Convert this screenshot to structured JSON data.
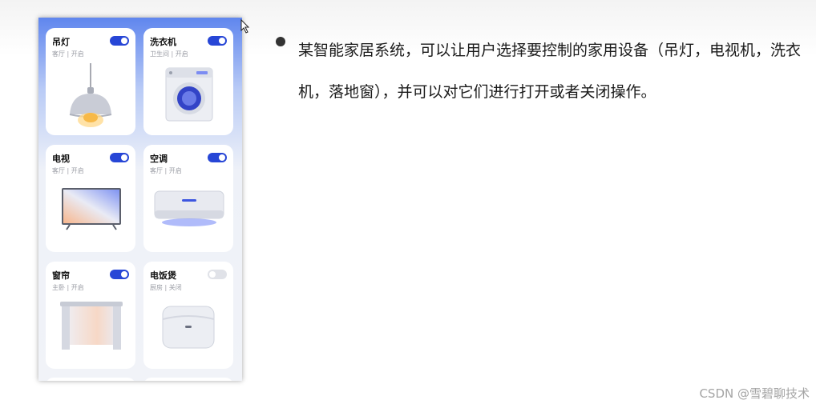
{
  "devices": [
    {
      "name": "吊灯",
      "location": "客厅 | 开启",
      "on": true,
      "icon": "pendant-lamp-icon"
    },
    {
      "name": "洗衣机",
      "location": "卫生间 | 开启",
      "on": true,
      "icon": "washing-machine-icon"
    },
    {
      "name": "电视",
      "location": "客厅 | 开启",
      "on": true,
      "icon": "tv-icon"
    },
    {
      "name": "空调",
      "location": "客厅 | 开启",
      "on": true,
      "icon": "air-conditioner-icon"
    },
    {
      "name": "窗帘",
      "location": "主卧 | 开启",
      "on": true,
      "icon": "curtain-icon"
    },
    {
      "name": "电饭煲",
      "location": "厨房 | 关闭",
      "on": false,
      "icon": "rice-cooker-icon"
    }
  ],
  "description": "某智能家居系统，可以让用户选择要控制的家用设备（吊灯，电视机，洗衣机，落地窗），并可以对它们进行打开或者关闭操作。",
  "watermark": "CSDN @雪碧聊技术",
  "colors": {
    "accent": "#2746d6",
    "toggle_off": "#e0e2e8"
  }
}
